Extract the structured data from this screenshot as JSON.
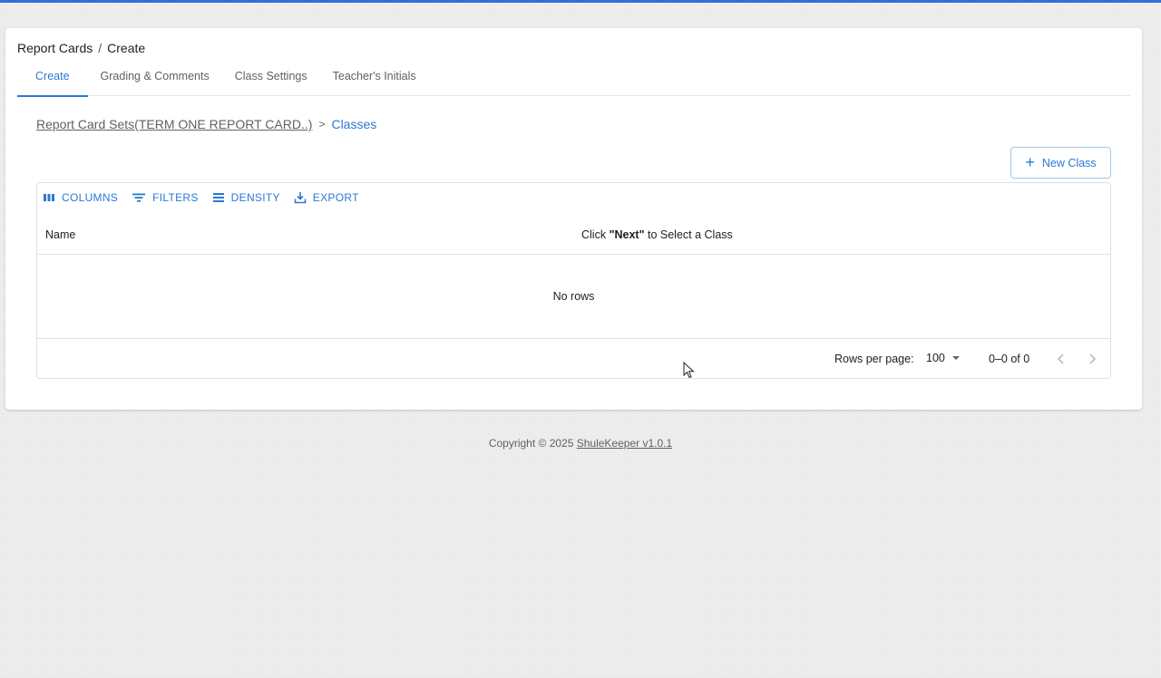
{
  "header": {
    "breadcrumb": [
      "Report Cards",
      "Create"
    ],
    "breadcrumb_separator": "/"
  },
  "tabs": [
    {
      "label": "Create",
      "active": true
    },
    {
      "label": "Grading & Comments",
      "active": false
    },
    {
      "label": "Class Settings",
      "active": false
    },
    {
      "label": "Teacher's Initials",
      "active": false
    }
  ],
  "inner_breadcrumb": {
    "parent": "Report Card Sets(TERM ONE REPORT CARD..)",
    "separator": ">",
    "current": "Classes"
  },
  "new_class_button": {
    "label": "New Class",
    "icon": "plus-icon"
  },
  "toolbar": {
    "columns": {
      "label": "COLUMNS",
      "icon": "columns-icon"
    },
    "filters": {
      "label": "FILTERS",
      "icon": "filter-icon"
    },
    "density": {
      "label": "DENSITY",
      "icon": "density-icon"
    },
    "export": {
      "label": "EXPORT",
      "icon": "export-icon"
    }
  },
  "table": {
    "columns": {
      "name": "Name",
      "next_prefix": "Click ",
      "next_bold": "\"Next\"",
      "next_suffix": " to Select a Class"
    },
    "rows": [],
    "empty_text": "No rows"
  },
  "pagination": {
    "rows_per_page_label": "Rows per page:",
    "rows_per_page_value": "100",
    "range": "0–0 of 0",
    "prev_icon": "chevron-left-icon",
    "next_icon": "chevron-right-icon"
  },
  "footer": {
    "prefix": "Copyright © 2025 ",
    "brand": "ShuleKeeper v1.0.1"
  },
  "colors": {
    "accent": "#2b78d3",
    "top_bar": "#2f6fd6",
    "text": "#212121",
    "muted": "#616161"
  }
}
